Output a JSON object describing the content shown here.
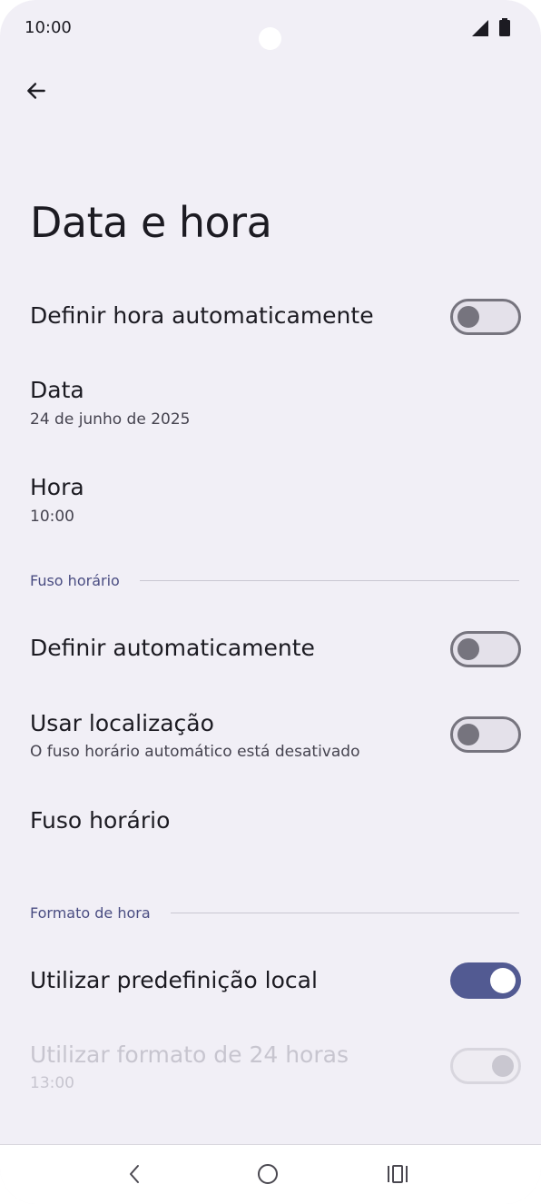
{
  "status_bar": {
    "time": "10:00"
  },
  "header": {
    "title": "Data e hora"
  },
  "settings": {
    "auto_time": {
      "title": "Definir hora automaticamente",
      "enabled": false
    },
    "date": {
      "title": "Data",
      "value": "24 de junho de 2025"
    },
    "time": {
      "title": "Hora",
      "value": "10:00"
    },
    "timezone_section": {
      "label": "Fuso horário"
    },
    "auto_timezone": {
      "title": "Definir automaticamente",
      "enabled": false
    },
    "use_location": {
      "title": "Usar localização",
      "subtitle": "O fuso horário automático está desativado",
      "enabled": false
    },
    "timezone": {
      "title": "Fuso horário"
    },
    "time_format_section": {
      "label": "Formato de hora"
    },
    "locale_default": {
      "title": "Utilizar predefinição local",
      "enabled": true
    },
    "format_24h": {
      "title": "Utilizar formato de 24 horas",
      "subtitle": "13:00",
      "enabled": true,
      "disabled": true
    }
  },
  "colors": {
    "accent": "#525a92",
    "background": "#f1eff6",
    "section_label": "#4a4d82"
  },
  "icons": {
    "back": "arrow-left-icon",
    "signal": "signal-icon",
    "battery": "battery-icon",
    "nav_back": "chevron-left-icon",
    "nav_home": "circle-home-icon",
    "nav_recents": "recents-icon"
  }
}
